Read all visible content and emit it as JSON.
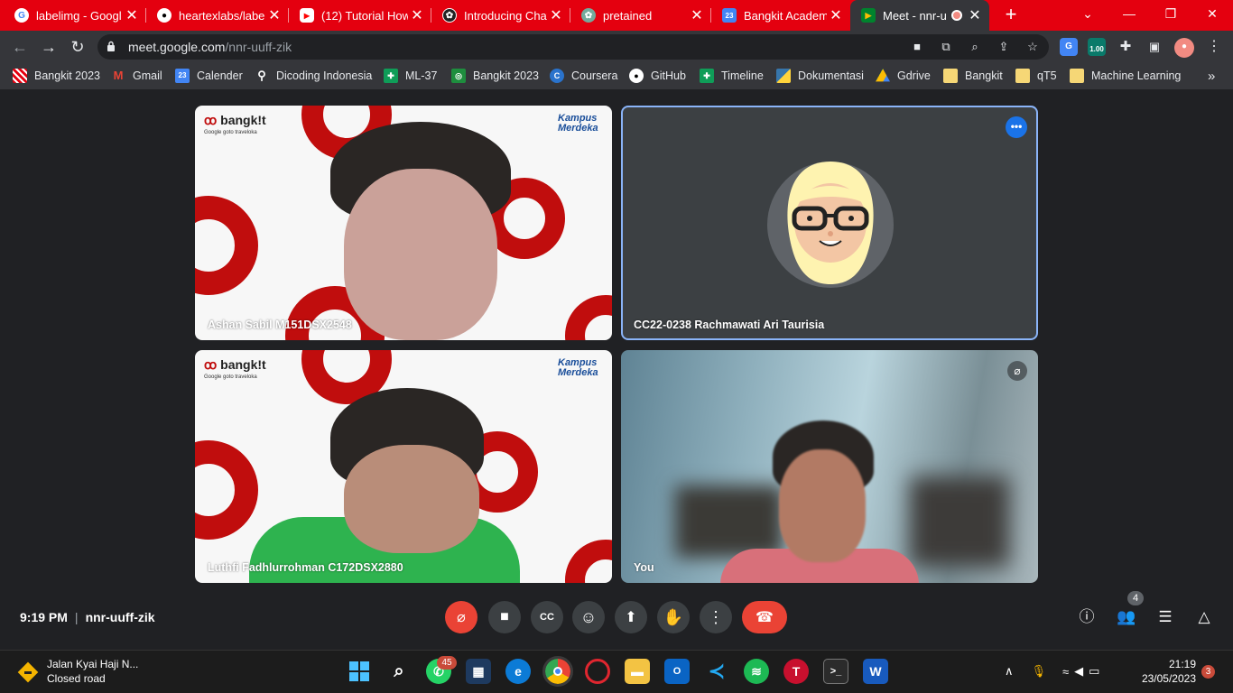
{
  "tabs": [
    {
      "title": "labelimg - Googl",
      "favicon": "google-icon"
    },
    {
      "title": "heartexlabs/label",
      "favicon": "github-icon"
    },
    {
      "title": "(12) Tutorial How",
      "favicon": "youtube-icon"
    },
    {
      "title": "Introducing Chat",
      "favicon": "openai-icon"
    },
    {
      "title": "pretained",
      "favicon": "chatgpt-icon"
    },
    {
      "title": "Bangkit Academy",
      "favicon": "calendar-icon"
    },
    {
      "title": "Meet - nnr-u",
      "favicon": "meet-icon",
      "active": true
    }
  ],
  "address": {
    "host": "meet.google.com",
    "path": "/nnr-uuff-zik"
  },
  "extension_badge": "1.00",
  "bookmarks": [
    "Bangkit 2023",
    "Gmail",
    "Calender",
    "Dicoding Indonesia",
    "ML-37",
    "Bangkit 2023",
    "Coursera",
    "GitHub",
    "Timeline",
    "Dokumentasi",
    "Gdrive",
    "Bangkit",
    "qT5",
    "Machine Learning"
  ],
  "bookmarks_overflow": "»",
  "tiles": {
    "t1": {
      "name": "Ashan Sabil M151DSX2548",
      "brand": "bangk!t",
      "sponsors": "Google  goto  traveloka",
      "badge": "Kampus Merdeka"
    },
    "t2": {
      "name": "CC22-0238 Rachmawati Ari Taurisia"
    },
    "t3": {
      "name": "Luthfi Fadhlurrohman C172DSX2880",
      "brand": "bangk!t",
      "sponsors": "Google  goto  traveloka",
      "badge": "Kampus Merdeka"
    },
    "t4": {
      "name": "You"
    }
  },
  "meeting": {
    "time": "9:19 PM",
    "code": "nnr-uuff-zik",
    "participants": "4"
  },
  "colors": {
    "tab_bar": "#e4000f",
    "accent_blue": "#8ab4f8",
    "hangup_red": "#ea4335",
    "bangkit_red": "#c00d0d"
  },
  "taskbar": {
    "weather_line1": "Jalan Kyai Haji N...",
    "weather_line2": "Closed road",
    "whatsapp_badge": "45",
    "time": "21:19",
    "date": "23/05/2023",
    "notifications": "3"
  }
}
